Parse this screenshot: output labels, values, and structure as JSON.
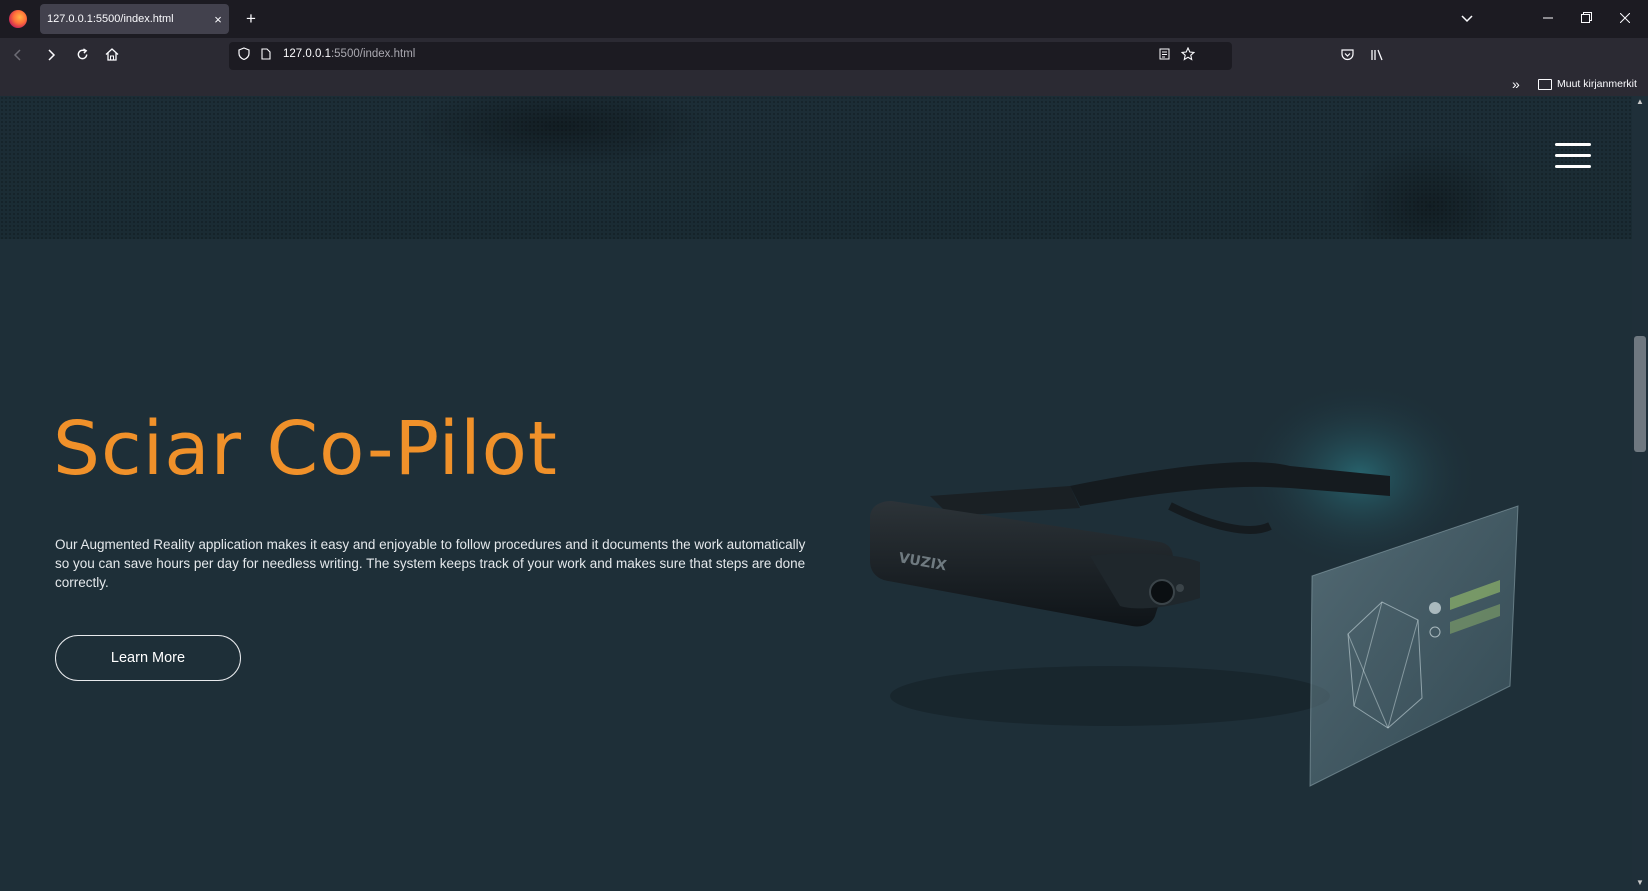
{
  "browser": {
    "tab_title": "127.0.0.1:5500/index.html",
    "tab_close": "×",
    "new_tab": "+",
    "url_host": "127.0.0.1",
    "url_rest": ":5500/index.html",
    "bookmarks_folder": "Muut kirjanmerkit",
    "bookmarks_overflow": "»"
  },
  "page": {
    "title": "Sciar Co-Pilot",
    "description": "Our Augmented Reality application makes it easy and enjoyable to follow procedures and it documents the work automatically so you can save hours per day for needless writing. The system keeps track of your work and makes sure that steps are done correctly.",
    "cta_label": "Learn More",
    "product_brand": "VUZIX"
  },
  "colors": {
    "accent": "#f0912a",
    "background": "#1e2f38"
  }
}
